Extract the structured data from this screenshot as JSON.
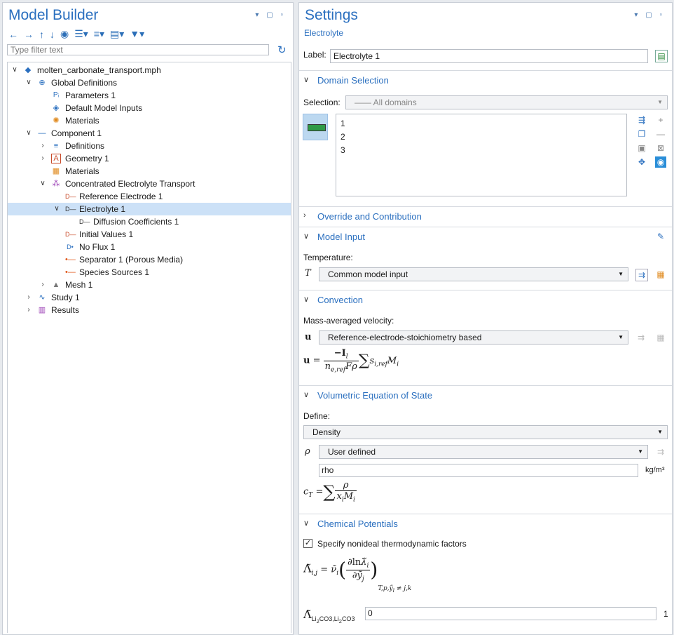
{
  "model_builder": {
    "title": "Model Builder",
    "filter_placeholder": "Type filter text",
    "tree": [
      {
        "label": "molten_carbonate_transport.mph",
        "chev": "∨",
        "level": 0
      },
      {
        "label": "Global Definitions",
        "chev": "∨",
        "level": 1
      },
      {
        "label": "Parameters 1",
        "chev": "",
        "level": 2
      },
      {
        "label": "Default Model Inputs",
        "chev": "",
        "level": 2
      },
      {
        "label": "Materials",
        "chev": "",
        "level": 2
      },
      {
        "label": "Component 1",
        "chev": "∨",
        "level": 1
      },
      {
        "label": "Definitions",
        "chev": "›",
        "level": 2
      },
      {
        "label": "Geometry 1",
        "chev": "›",
        "level": 2
      },
      {
        "label": "Materials",
        "chev": "",
        "level": 2
      },
      {
        "label": "Concentrated Electrolyte Transport",
        "chev": "∨",
        "level": 2
      },
      {
        "label": "Reference Electrode 1",
        "chev": "",
        "level": 3
      },
      {
        "label": "Electrolyte 1",
        "chev": "∨",
        "level": 3
      },
      {
        "label": "Diffusion Coefficients 1",
        "chev": "",
        "level": 4
      },
      {
        "label": "Initial Values 1",
        "chev": "",
        "level": 3
      },
      {
        "label": "No Flux 1",
        "chev": "",
        "level": 3
      },
      {
        "label": "Separator 1 (Porous Media)",
        "chev": "",
        "level": 3
      },
      {
        "label": "Species Sources 1",
        "chev": "",
        "level": 3
      },
      {
        "label": "Mesh 1",
        "chev": "›",
        "level": 2
      },
      {
        "label": "Study 1",
        "chev": "›",
        "level": 1
      },
      {
        "label": "Results",
        "chev": "›",
        "level": 1
      }
    ]
  },
  "settings": {
    "title": "Settings",
    "subtitle": "Electrolyte",
    "label_caption": "Label:",
    "label_value": "Electrolyte 1",
    "domain_selection": {
      "title": "Domain Selection",
      "selection_caption": "Selection:",
      "selection_value": "All domains",
      "domains": [
        "1",
        "2",
        "3"
      ]
    },
    "override": {
      "title": "Override and Contribution"
    },
    "model_input": {
      "title": "Model Input",
      "temperature_caption": "Temperature:",
      "symbol": "T",
      "value": "Common model input"
    },
    "convection": {
      "title": "Convection",
      "caption": "Mass-averaged velocity:",
      "symbol": "u",
      "value": "Reference-electrode-stoichiometry based"
    },
    "veos": {
      "title": "Volumetric Equation of State",
      "define_caption": "Define:",
      "define_value": "Density",
      "rho_symbol": "ρ",
      "rho_value": "User defined",
      "rho_expr": "rho",
      "rho_unit": "kg/m³"
    },
    "chem": {
      "title": "Chemical Potentials",
      "checkbox_label": "Specify nonideal thermodynamic factors",
      "factor_value": "0",
      "factor_unit": "1"
    }
  }
}
